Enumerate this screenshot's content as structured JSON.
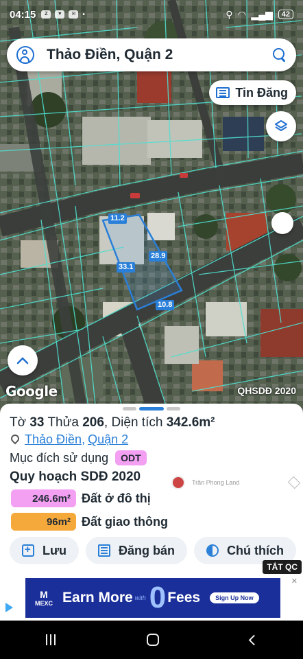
{
  "status_bar": {
    "time": "04:15",
    "battery": "42"
  },
  "search": {
    "query": "Thảo Điền, Quận 2"
  },
  "map": {
    "tin_dang_label": "Tin Đăng",
    "dimensions": [
      "11.2",
      "28.9",
      "33.1",
      "10.8"
    ],
    "attribution": "Google",
    "layer_name": "QHSDĐ 2020"
  },
  "parcel": {
    "to_label": "Tờ",
    "to_value": "33",
    "thua_label": "Thửa",
    "thua_value": "206",
    "dientich_label": "Diện tích",
    "dientich_value": "342.6m²",
    "ward": "Thảo Điền",
    "district": "Quận 2",
    "purpose_label": "Mục đích sử dụng",
    "purpose_code": "ODT",
    "plan_title": "Quy hoạch SDĐ 2020",
    "legend": [
      {
        "area": "246.6m²",
        "label": "Đất ở đô thị",
        "color": "#f39ff2"
      },
      {
        "area": "96m²",
        "label": "Đất giao thông",
        "color": "#f6a93b"
      }
    ],
    "actions": [
      "Lưu",
      "Đăng bán",
      "Chú thích"
    ]
  },
  "watermark": {
    "text": "Trần Phong Land"
  },
  "ad": {
    "close_label": "TẮT QC",
    "brand": "MEXC",
    "headline_1": "Earn More",
    "with": "with",
    "zero": "0",
    "headline_2": "Fees",
    "cta": "Sign Up Now"
  }
}
